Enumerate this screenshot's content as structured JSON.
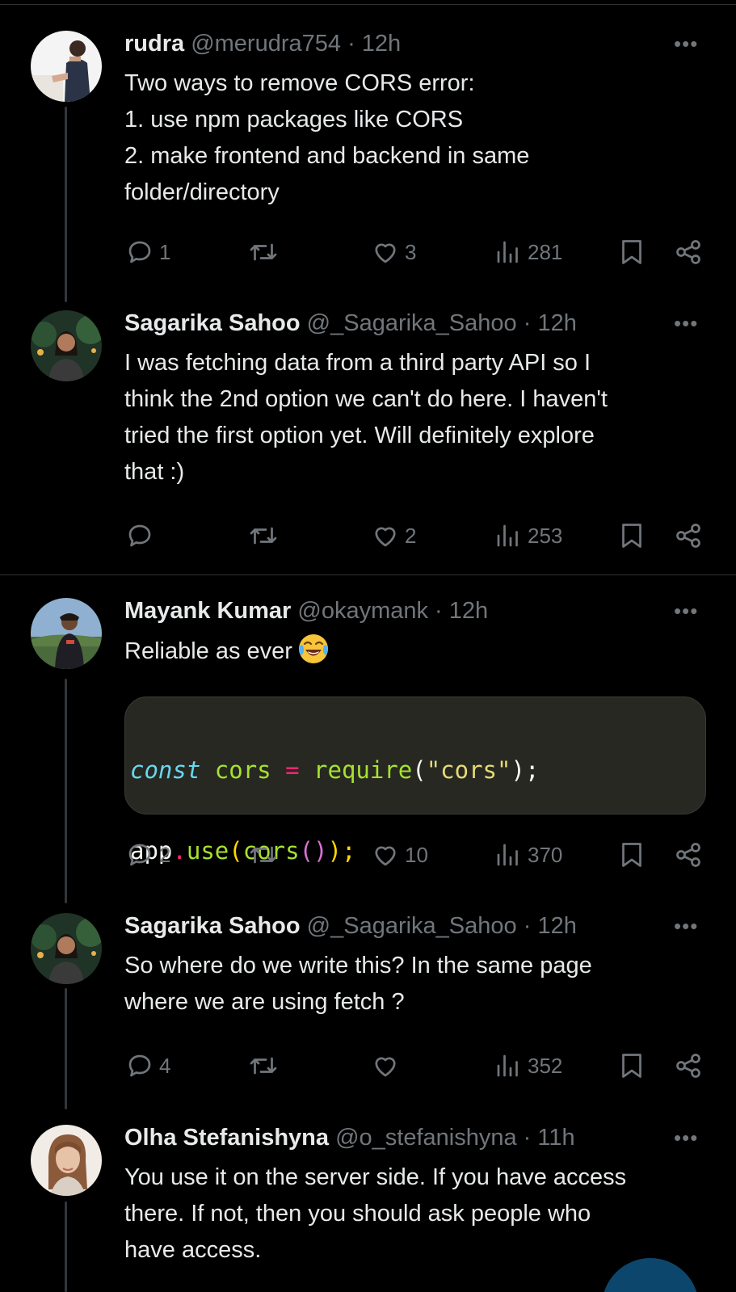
{
  "tweets": [
    {
      "name": "rudra",
      "handle": "@merudra754",
      "time": "12h",
      "lines": [
        "Two ways to remove CORS error:",
        "1. use npm packages like CORS",
        "2. make frontend and backend in same",
        "folder/directory"
      ],
      "replies": "1",
      "likes": "3",
      "views": "281"
    },
    {
      "name": "Sagarika Sahoo",
      "handle": "@_Sagarika_Sahoo",
      "time": "12h",
      "lines": [
        "I was fetching data from a third party API so I",
        "think the 2nd option we can't do here. I haven't",
        "tried the first option yet. Will definitely explore",
        "that :)"
      ],
      "replies": "",
      "likes": "2",
      "views": "253"
    },
    {
      "name": "Mayank Kumar",
      "handle": "@okaymank",
      "time": "12h",
      "lines": [
        "Reliable as ever"
      ],
      "emoji": "face-with-tears-of-joy",
      "code": {
        "line1": {
          "kw": "const",
          "var": "cors",
          "op": "=",
          "fn": "require",
          "p1": "(",
          "str": "\"cors\"",
          "p2": ");"
        },
        "line2": {
          "obj": "app",
          "dot": ".",
          "fn": "use",
          "p1": "(",
          "fn2": "cors",
          "p2": "()",
          "p3": ");"
        }
      },
      "replies": "2",
      "likes": "10",
      "views": "370"
    },
    {
      "name": "Sagarika Sahoo",
      "handle": "@_Sagarika_Sahoo",
      "time": "12h",
      "lines": [
        "So where do we write this? In the same page",
        "where we are using fetch ?"
      ],
      "replies": "4",
      "likes": "",
      "views": "352"
    },
    {
      "name": "Olha Stefanishyna",
      "handle": "@o_stefanishyna",
      "time": "11h",
      "lines": [
        "You use it on the server side. If you have access",
        "there. If not, then you should ask people who",
        "have access."
      ]
    }
  ],
  "separator": " · ",
  "more_label": "•••",
  "colors": {
    "background": "#000000",
    "text": "#e7e9ea",
    "secondary": "#71767b",
    "accent": "#1d9bf0"
  }
}
